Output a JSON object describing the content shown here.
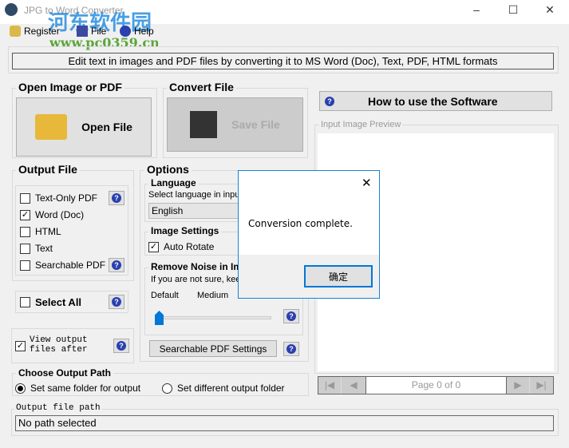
{
  "window": {
    "title": "JPG to Word Converter",
    "controls": [
      "minimize",
      "maximize",
      "close"
    ]
  },
  "watermark": {
    "text": "河东软件园",
    "url": "www.pc0359.cn"
  },
  "menu": [
    {
      "label": "Register",
      "icon": "key-icon"
    },
    {
      "label": "File",
      "icon": "floppy-icon"
    },
    {
      "label": "Help",
      "icon": "help-icon"
    }
  ],
  "banner": "Edit text in images and PDF files by converting it to MS Word (Doc), Text, PDF, HTML formats",
  "open_group": {
    "label": "Open Image or PDF",
    "button": "Open File"
  },
  "convert_group": {
    "label": "Convert File",
    "button": "Save File"
  },
  "how_to": "How to use the Software",
  "preview": {
    "label": "Input Image Preview",
    "page": "Page 0 of 0"
  },
  "output_file": {
    "label": "Output File",
    "items": [
      {
        "label": "Text-Only PDF",
        "checked": false,
        "help": true
      },
      {
        "label": "Word (Doc)",
        "checked": true,
        "help": false
      },
      {
        "label": "HTML",
        "checked": false,
        "help": false
      },
      {
        "label": "Text",
        "checked": false,
        "help": false
      },
      {
        "label": "Searchable PDF",
        "checked": false,
        "help": true
      }
    ],
    "select_all": "Select All",
    "view_after_line1": "View output",
    "view_after_line2": "files after",
    "view_after_checked": true
  },
  "options": {
    "label": "Options",
    "language_label": "Language",
    "language_hint": "Select language in input",
    "language_value": "English",
    "image_settings": "Image Settings",
    "auto_rotate": "Auto Rotate",
    "auto_rotate_checked": true,
    "noise_label": "Remove Noise in Im",
    "noise_hint": "If you are not sure, kee",
    "noise_levels": [
      "Default",
      "Medium"
    ],
    "noise_value": 0,
    "searchable_pdf_button": "Searchable PDF Settings"
  },
  "output_path": {
    "label": "Choose Output Path",
    "options": [
      "Set same folder for output",
      "Set different output folder"
    ],
    "selected": 0
  },
  "path": {
    "label": "Output file path",
    "value": "No path selected"
  },
  "dialog": {
    "message": "Conversion complete.",
    "ok": "确定"
  }
}
